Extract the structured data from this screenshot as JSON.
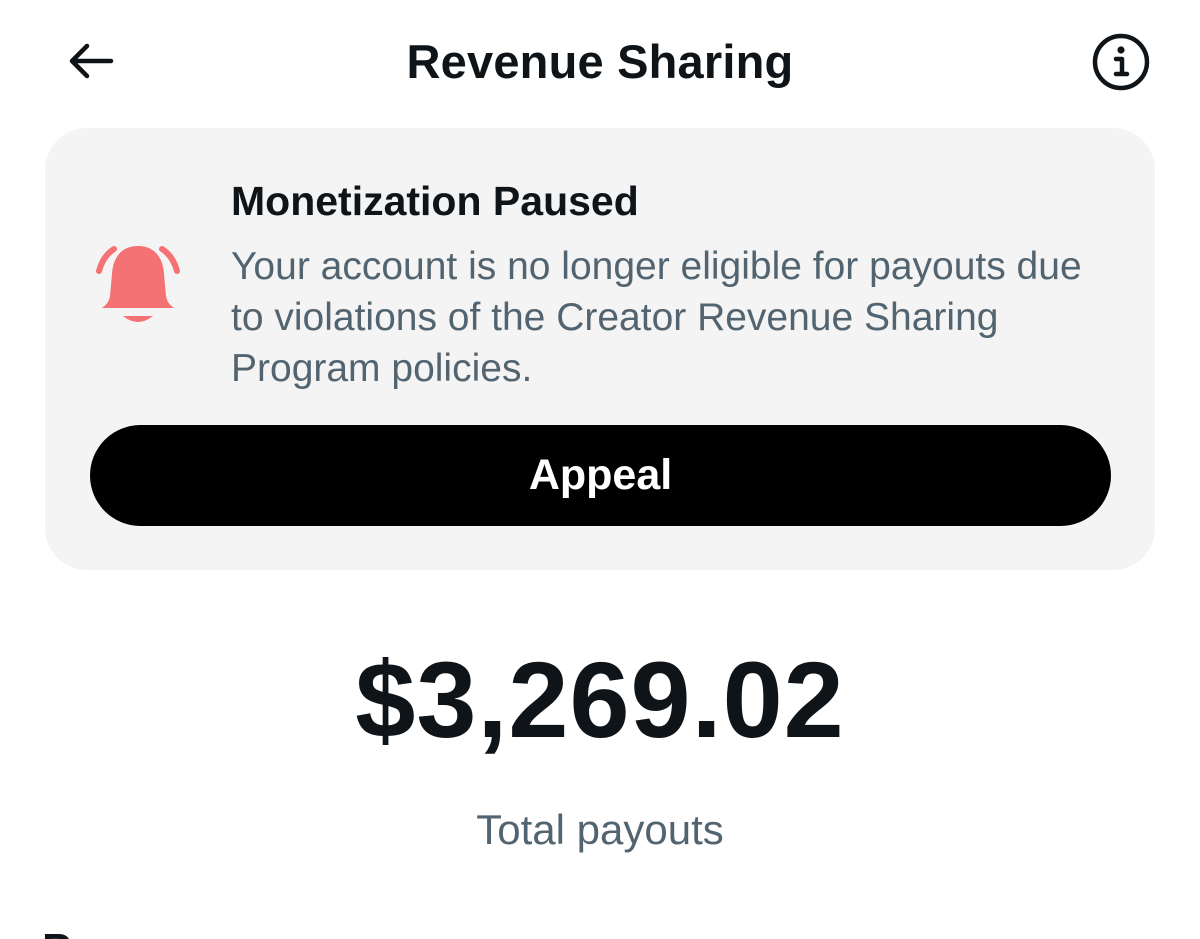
{
  "header": {
    "title": "Revenue Sharing",
    "back_icon": "arrow-left-icon",
    "info_icon": "info-circle-icon"
  },
  "alert": {
    "icon": "bell-ringing-icon",
    "icon_color": "#f47174",
    "title": "Monetization Paused",
    "body": "Your account is no longer eligible for payouts due to violations of the Creator Revenue Sharing Program policies.",
    "button_label": "Appeal"
  },
  "totals": {
    "amount": "$3,269.02",
    "label": "Total payouts"
  },
  "next_section": {
    "partial_text": "P"
  }
}
